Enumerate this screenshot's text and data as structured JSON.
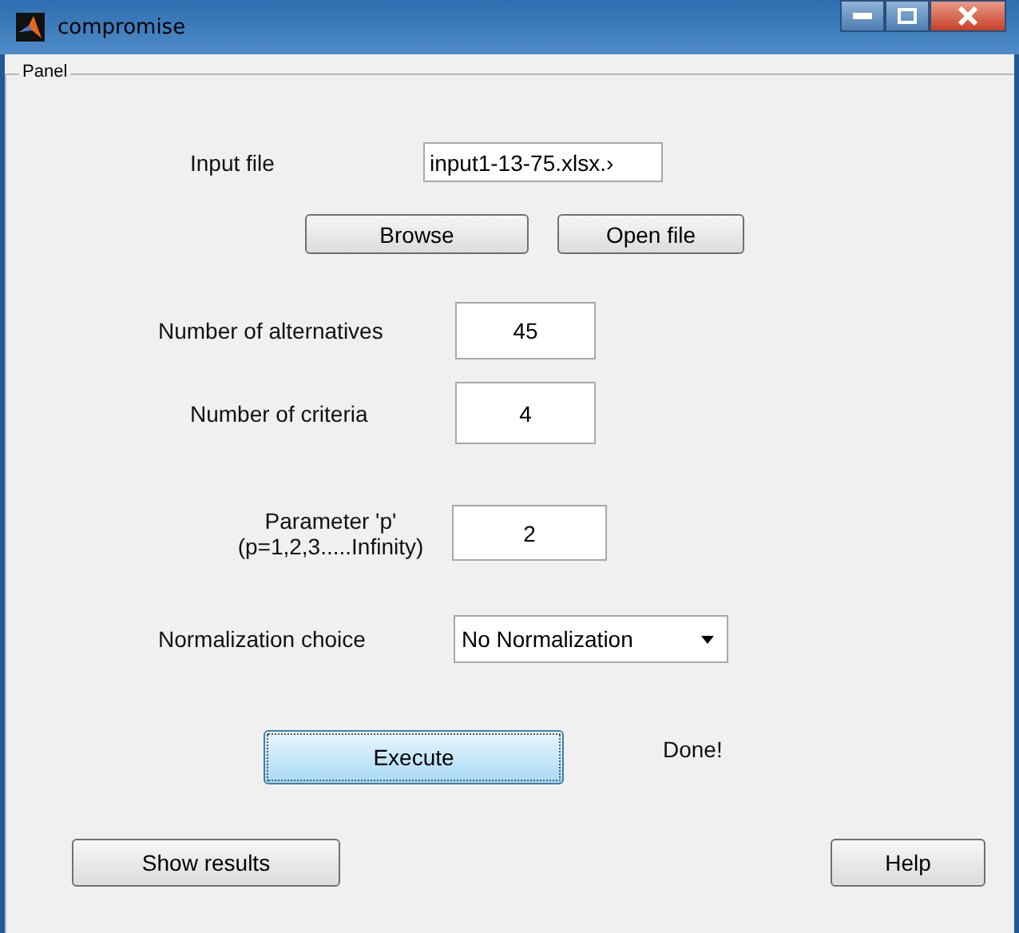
{
  "window": {
    "title": "compromise"
  },
  "panel": {
    "title": "Panel"
  },
  "input_file": {
    "label": "Input file",
    "value": "input1-13-75.xlsx.›"
  },
  "file_buttons": [
    {
      "label": "Browse"
    },
    {
      "label": "Open file"
    }
  ],
  "alternatives": {
    "label": "Number of alternatives",
    "value": "45"
  },
  "criteria": {
    "label": "Number of criteria",
    "value": "4"
  },
  "parameter": {
    "label": "Parameter 'p'",
    "hint": "(p=1,2,3.....Infinity)",
    "value": "2"
  },
  "normalization": {
    "label": "Normalization choice",
    "value": "No Normalization"
  },
  "execute": {
    "label": "Execute",
    "focused": true
  },
  "status": "Done!",
  "bottom_buttons": [
    {
      "label": "Show results"
    },
    {
      "label": "Help"
    }
  ]
}
